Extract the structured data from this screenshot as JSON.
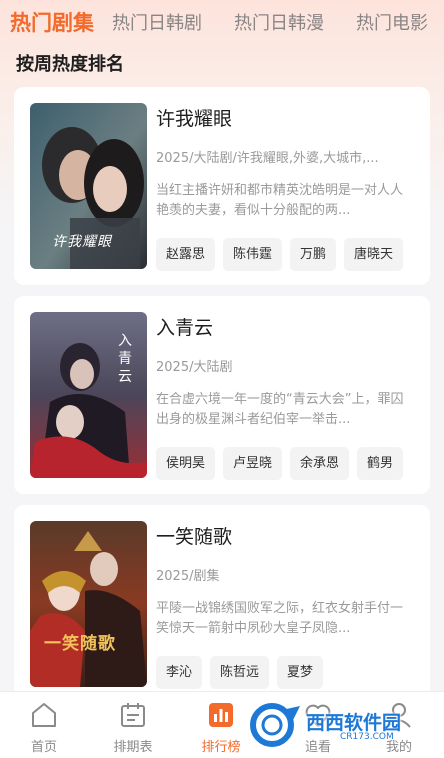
{
  "tabs": [
    {
      "label": "热门剧集",
      "active": true
    },
    {
      "label": "热门日韩剧",
      "active": false
    },
    {
      "label": "热门日韩漫",
      "active": false
    },
    {
      "label": "热门电影",
      "active": false
    }
  ],
  "section_title": "按周热度排名",
  "dramas": [
    {
      "title": "许我耀眼",
      "meta": "2025/大陆剧/许我耀眼,外婆,大城市,...",
      "desc": "当红主播许妍和都市精英沈皓明是一对人人艳羡的夫妻，看似十分般配的两...",
      "poster_text": "许我耀眼",
      "cast": [
        "赵露思",
        "陈伟霆",
        "万鹏",
        "唐晓天"
      ]
    },
    {
      "title": "入青云",
      "meta": "2025/大陆剧",
      "desc": "在合虚六境一年一度的“青云大会”上，罪囚出身的极星渊斗者纪伯宰一举击...",
      "poster_text": "入青云",
      "cast": [
        "侯明昊",
        "卢昱晓",
        "余承恩",
        "鹤男"
      ]
    },
    {
      "title": "一笑随歌",
      "meta": "2025/剧集",
      "desc": "平陵一战锦绣国败军之际，红衣女射手付一笑惊天一箭射中夙砂大皇子凤隐...",
      "poster_text": "一笑随歌",
      "cast": [
        "李沁",
        "陈哲远",
        "夏梦"
      ]
    }
  ],
  "nav": [
    {
      "label": "首页",
      "icon": "home-icon",
      "active": false
    },
    {
      "label": "排期表",
      "icon": "calendar-icon",
      "active": false
    },
    {
      "label": "排行榜",
      "icon": "ranking-icon",
      "active": true
    },
    {
      "label": "追看",
      "icon": "follow-icon",
      "active": false
    },
    {
      "label": "我的",
      "icon": "profile-icon",
      "active": false
    }
  ],
  "watermark": {
    "text": "西西软件园",
    "sub": "CR173.COM"
  },
  "colors": {
    "accent": "#f36a2b",
    "background": "#f5f5f7"
  }
}
